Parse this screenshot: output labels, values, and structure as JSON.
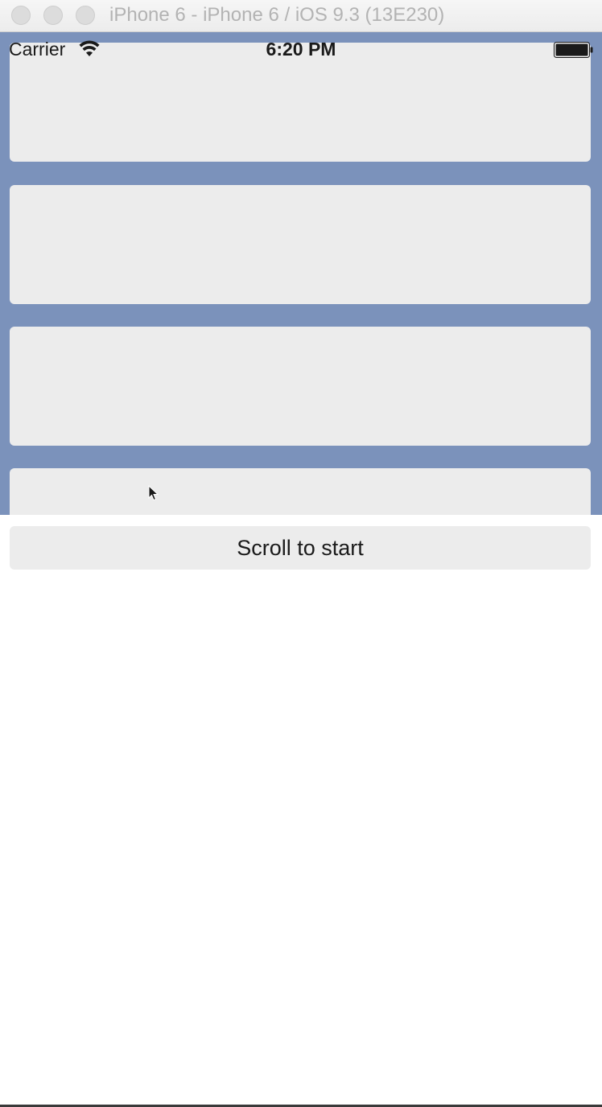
{
  "window": {
    "title": "iPhone 6 - iPhone 6 / iOS 9.3 (13E230)"
  },
  "status_bar": {
    "carrier": "Carrier",
    "time": "6:20 PM",
    "wifi_icon": "wifi-icon",
    "battery_icon": "battery-icon"
  },
  "list": {
    "background_color": "#7b92bb",
    "card_color": "#ececec",
    "visible_cards": 4
  },
  "actions": {
    "scroll_to_start_label": "Scroll to start"
  },
  "cursor": {
    "icon": "pointer-cursor-icon"
  }
}
